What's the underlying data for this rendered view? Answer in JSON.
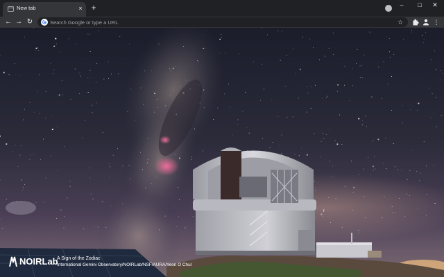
{
  "tab": {
    "title": "New tab",
    "close_glyph": "×"
  },
  "tabstrip": {
    "new_tab_glyph": "+",
    "minimize_glyph": "–",
    "maximize_glyph": "□",
    "close_glyph": "✕"
  },
  "toolbar": {
    "back_glyph": "←",
    "forward_glyph": "→",
    "reload_glyph": "↻",
    "omnibox_placeholder": "Search Google or type a URL",
    "star_glyph": "☆",
    "menu_glyph": "⋮"
  },
  "attribution": {
    "logo_text": "NOIRLab",
    "title": "A Sign of the Zodiac",
    "credit": "International Gemini Observatory/NOIRLab/NSF/AURA/Yeon O Chul"
  },
  "icons": {
    "back": "back-arrow-icon",
    "forward": "forward-arrow-icon",
    "reload": "reload-icon",
    "google": "google-g-icon",
    "star": "bookmark-star-icon",
    "extensions": "puzzle-icon",
    "profile": "person-icon",
    "menu": "kebab-menu-icon",
    "logo": "noirlab-logo-icon"
  },
  "colors": {
    "tabstrip_bg": "#202124",
    "toolbar_bg": "#35363a",
    "omnibox_bg": "#202124",
    "text": "#e8eaed",
    "placeholder": "#9aa0a6"
  }
}
